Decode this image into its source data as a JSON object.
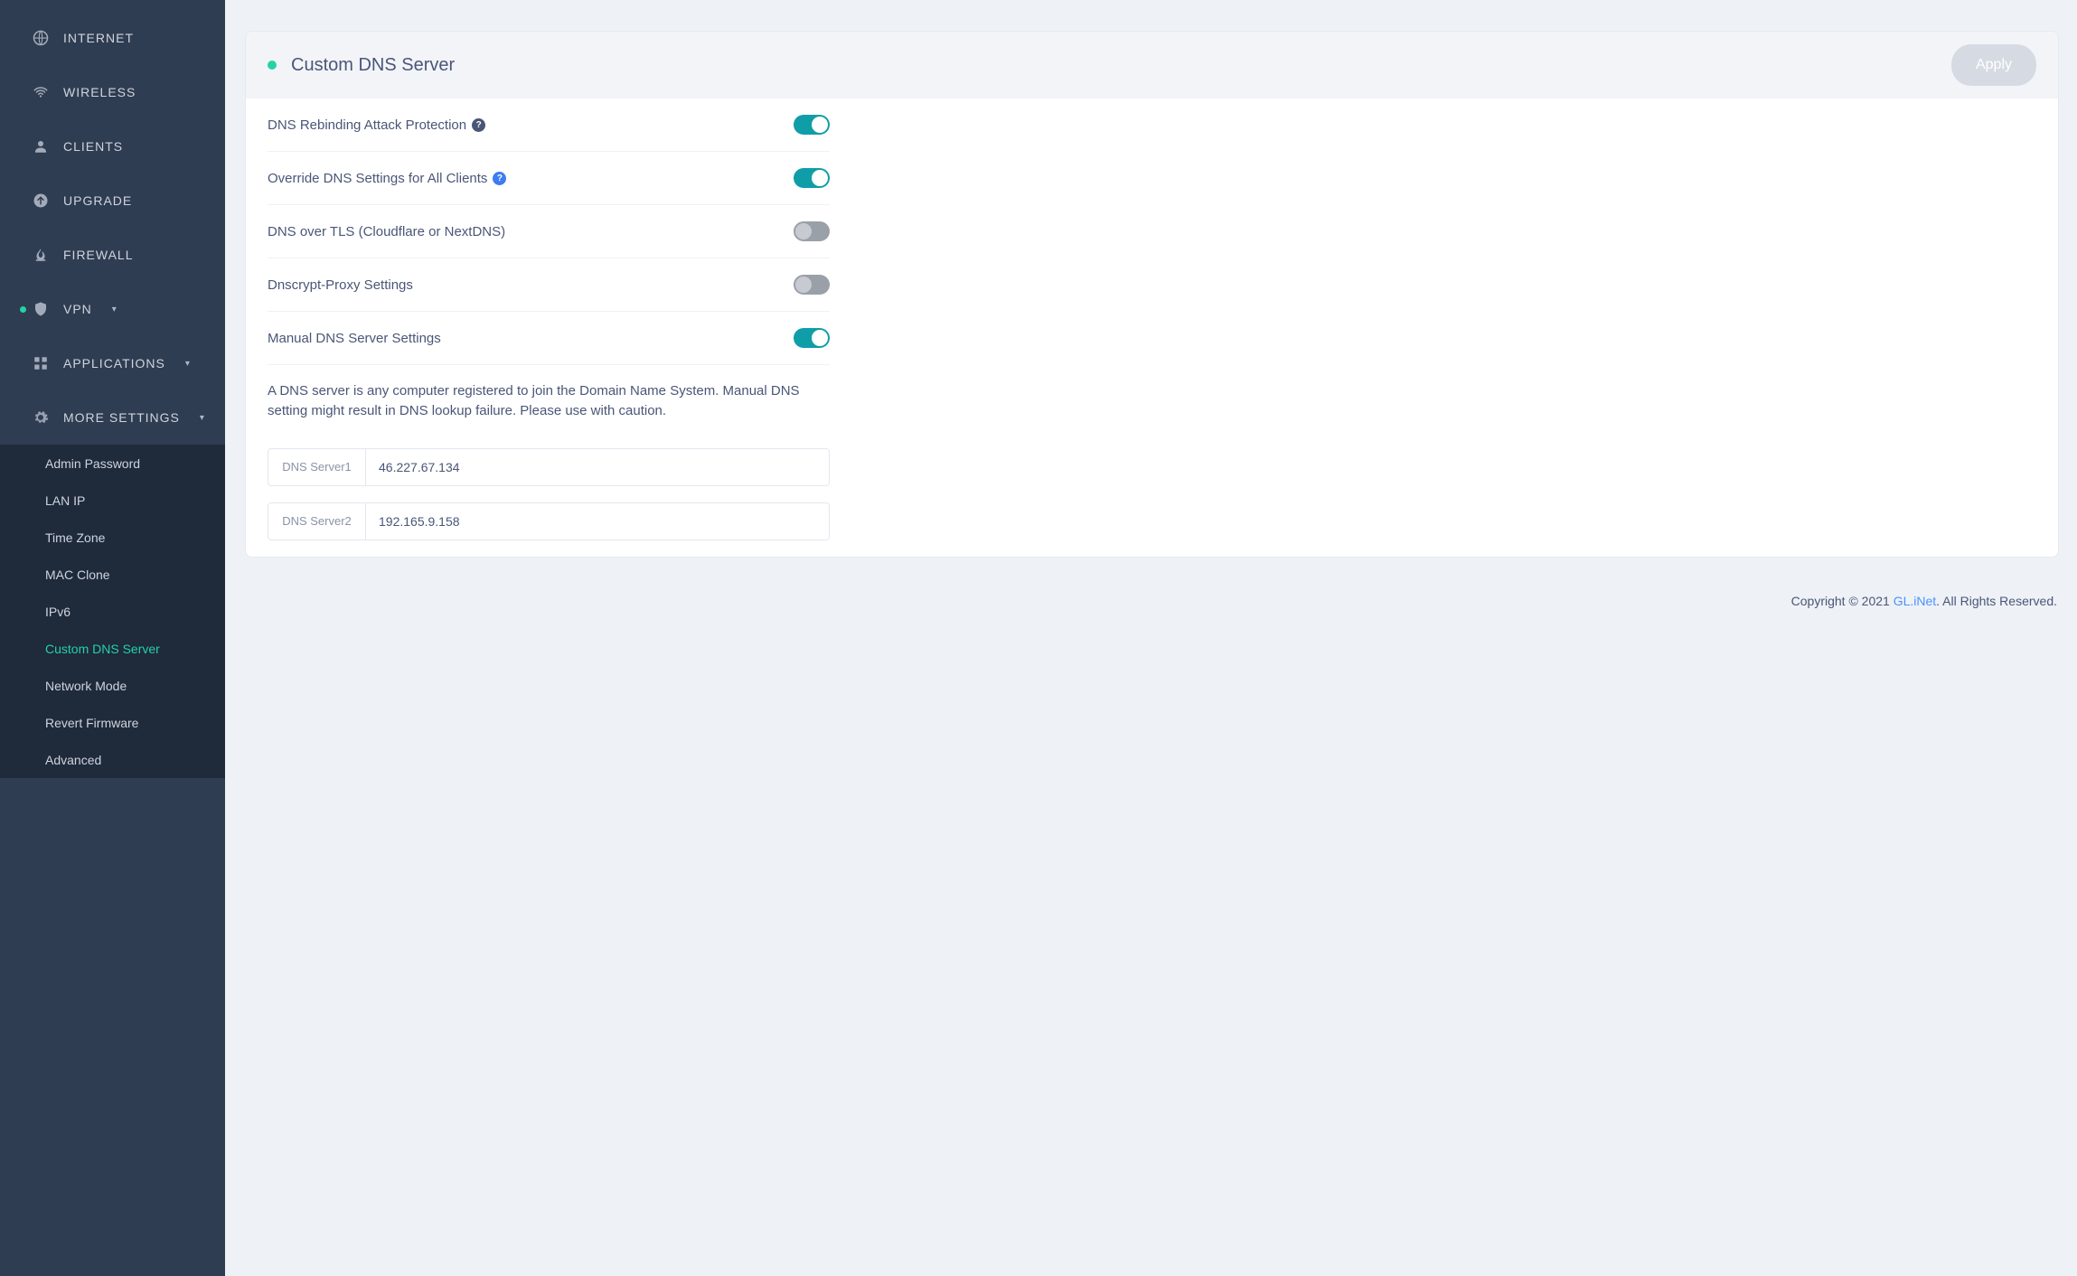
{
  "sidebar": {
    "items": [
      {
        "label": "INTERNET",
        "icon": "globe"
      },
      {
        "label": "WIRELESS",
        "icon": "wifi"
      },
      {
        "label": "CLIENTS",
        "icon": "user"
      },
      {
        "label": "UPGRADE",
        "icon": "upload"
      },
      {
        "label": "FIREWALL",
        "icon": "flame"
      },
      {
        "label": "VPN",
        "icon": "shield",
        "dropdown": true,
        "dot": true
      },
      {
        "label": "APPLICATIONS",
        "icon": "grid",
        "dropdown": true
      },
      {
        "label": "MORE SETTINGS",
        "icon": "gear",
        "dropdown": true
      }
    ],
    "sub": [
      {
        "label": "Admin Password"
      },
      {
        "label": "LAN IP"
      },
      {
        "label": "Time Zone"
      },
      {
        "label": "MAC Clone"
      },
      {
        "label": "IPv6"
      },
      {
        "label": "Custom DNS Server",
        "active": true
      },
      {
        "label": "Network Mode"
      },
      {
        "label": "Revert Firmware"
      },
      {
        "label": "Advanced"
      }
    ]
  },
  "header": {
    "title": "Custom DNS Server",
    "apply": "Apply"
  },
  "rows": [
    {
      "label": "DNS Rebinding Attack Protection",
      "help": true,
      "on": true
    },
    {
      "label": "Override DNS Settings for All Clients",
      "help": true,
      "on": true
    },
    {
      "label": "DNS over TLS (Cloudflare or NextDNS)",
      "help": false,
      "on": false
    },
    {
      "label": "Dnscrypt-Proxy Settings",
      "help": false,
      "on": false
    },
    {
      "label": "Manual DNS Server Settings",
      "help": false,
      "on": true
    }
  ],
  "note": "A DNS server is any computer registered to join the Domain Name System. Manual DNS setting might result in DNS lookup failure. Please use with caution.",
  "dns": {
    "label1": "DNS Server1",
    "value1": "46.227.67.134",
    "label2": "DNS Server2",
    "value2": "192.165.9.158"
  },
  "footer": {
    "prefix": "Copyright © 2021 ",
    "brand": "GL.iNet",
    "suffix": ". All Rights Reserved."
  }
}
